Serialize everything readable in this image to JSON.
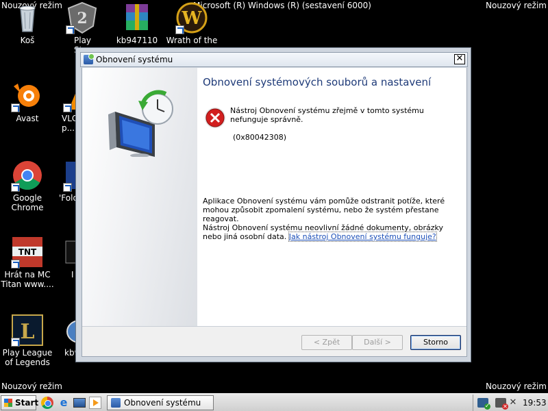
{
  "desktop": {
    "mode_label": "Nouzový režim",
    "build_text": "Microsoft (R) Windows (R) (sestavení 6000)",
    "icons": [
      {
        "label": "Koš",
        "icon": "recycle-bin-icon"
      },
      {
        "label": "Play Stron...",
        "icon": "game-shield-icon"
      },
      {
        "label": "kb947110",
        "icon": "archive-icon"
      },
      {
        "label": "Wrath of the",
        "icon": "wow-icon"
      },
      {
        "label": "Avast",
        "icon": "avast-icon"
      },
      {
        "label": "VLC p...",
        "icon": "vlc-icon"
      },
      {
        "label": "Google Chrome",
        "icon": "chrome-icon"
      },
      {
        "label": "'Fold",
        "icon": "folder-app-icon"
      },
      {
        "label": "Hrát na MC Titan www....",
        "icon": "tnt-icon"
      },
      {
        "label": "I",
        "icon": "app-icon"
      },
      {
        "label": "Play League of Legends",
        "icon": "league-icon"
      },
      {
        "label": "kb9",
        "icon": "installer-icon"
      }
    ]
  },
  "dialog": {
    "title": "Obnovení systému",
    "heading": "Obnovení systémových souborů a nastavení",
    "error_message": "Nástroj Obnovení systému zřejmě v tomto systému nefunguje správně.",
    "error_code": "(0x80042308)",
    "info_text": "Aplikace Obnovení systému vám pomůže odstranit potíže, které mohou způsobit zpomalení systému, nebo že systém přestane reagovat.",
    "docs_text": "Nástroj Obnovení systému neovlivní žádné dokumenty, obrázky nebo jiná osobní data.",
    "help_link": "Jak nástroj Obnovení systému funguje?",
    "buttons": {
      "back": "< Zpět",
      "next": "Další >",
      "cancel": "Storno"
    }
  },
  "taskbar": {
    "start_label": "Start",
    "task_label": "Obnovení systému",
    "clock": "19:53"
  }
}
